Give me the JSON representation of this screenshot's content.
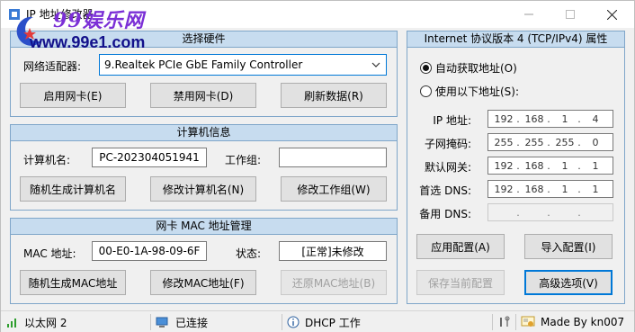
{
  "window": {
    "title": "IP 地址修改器",
    "watermark_top": "99娱乐网",
    "watermark_bottom": "www.99e1.com"
  },
  "hardware": {
    "header": "选择硬件",
    "adapter_label": "网络适配器:",
    "adapter_value": "9.Realtek PCIe GbE Family Controller",
    "enable_btn": "启用网卡(E)",
    "disable_btn": "禁用网卡(D)",
    "refresh_btn": "刷新数据(R)"
  },
  "computer": {
    "header": "计算机信息",
    "name_label": "计算机名:",
    "name_value": "PC-202304051941",
    "workgroup_label": "工作组:",
    "workgroup_value": "",
    "random_btn": "随机生成计算机名",
    "modify_name_btn": "修改计算机名(N)",
    "modify_wg_btn": "修改工作组(W)"
  },
  "mac": {
    "header": "网卡 MAC 地址管理",
    "mac_label": "MAC 地址:",
    "mac_value": "00-E0-1A-98-09-6F",
    "status_label": "状态:",
    "status_value": "[正常]未修改",
    "random_btn": "随机生成MAC地址",
    "modify_btn": "修改MAC地址(F)",
    "restore_btn": "还原MAC地址(B)"
  },
  "ipv4": {
    "header": "Internet 协议版本 4 (TCP/IPv4) 属性",
    "auto_label": "自动获取地址(O)",
    "manual_label": "使用以下地址(S):",
    "auto_selected": true,
    "ip_label": "IP 地址:",
    "mask_label": "子网掩码:",
    "gateway_label": "默认网关:",
    "dns1_label": "首选 DNS:",
    "dns2_label": "备用 DNS:",
    "ip": [
      "192",
      "168",
      "1",
      "4"
    ],
    "mask": [
      "255",
      "255",
      "255",
      "0"
    ],
    "gateway": [
      "192",
      "168",
      "1",
      "1"
    ],
    "dns1": [
      "192",
      "168",
      "1",
      "1"
    ],
    "dns2": [
      "",
      "",
      "",
      ""
    ],
    "apply_btn": "应用配置(A)",
    "import_btn": "导入配置(I)",
    "save_btn": "保存当前配置",
    "advanced_btn": "高级选项(V)"
  },
  "status": {
    "network": "以太网 2",
    "connection": "已连接",
    "dhcp": "DHCP 工作",
    "author": "Made By kn007"
  },
  "colors": {
    "panel_border": "#7fa6c9",
    "panel_header": "#c7dcef",
    "accent": "#0078d7"
  }
}
